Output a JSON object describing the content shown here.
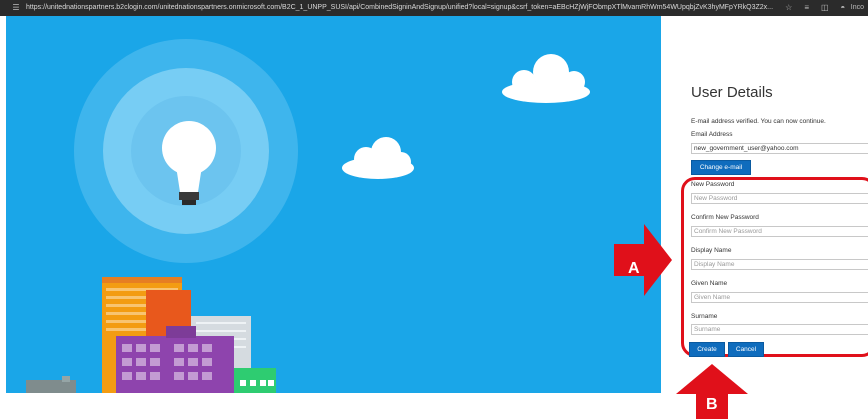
{
  "browser": {
    "url": "https://unitednationspartners.b2clogin.com/unitednationspartners.onmicrosoft.com/B2C_1_UNPP_SUSI/api/CombinedSigninAndSignup/unified?local=signup&csrf_token=aEBcHZjWjFObmpXTlMvamRhWm54WUpqbjZvK3hyMFpYRkQ3Z2x...",
    "profile_label": "Inco"
  },
  "form": {
    "title": "User Details",
    "verified_message": "E-mail address verified. You can now continue.",
    "email_label": "Email Address",
    "email_value": "new_government_user@yahoo.com",
    "change_email_label": "Change e-mail",
    "new_password_label": "New Password",
    "new_password_placeholder": "New Password",
    "confirm_password_label": "Confirm New Password",
    "confirm_password_placeholder": "Confirm New Password",
    "display_name_label": "Display Name",
    "display_name_placeholder": "Display Name",
    "given_name_label": "Given Name",
    "given_name_placeholder": "Given Name",
    "surname_label": "Surname",
    "surname_placeholder": "Surname",
    "create_label": "Create",
    "cancel_label": "Cancel"
  },
  "annotations": {
    "arrow_a_label": "A",
    "arrow_b_label": "B",
    "highlight_color": "#e0101a"
  },
  "icons": [
    "menu-icon",
    "star-icon",
    "reading-list-icon",
    "split-screen-icon",
    "incognito-icon",
    "lightbulb-icon",
    "cloud-icon",
    "city-buildings-icon"
  ],
  "colors": {
    "sky": "#1aa6e8",
    "button_blue": "#0f6cbd"
  }
}
